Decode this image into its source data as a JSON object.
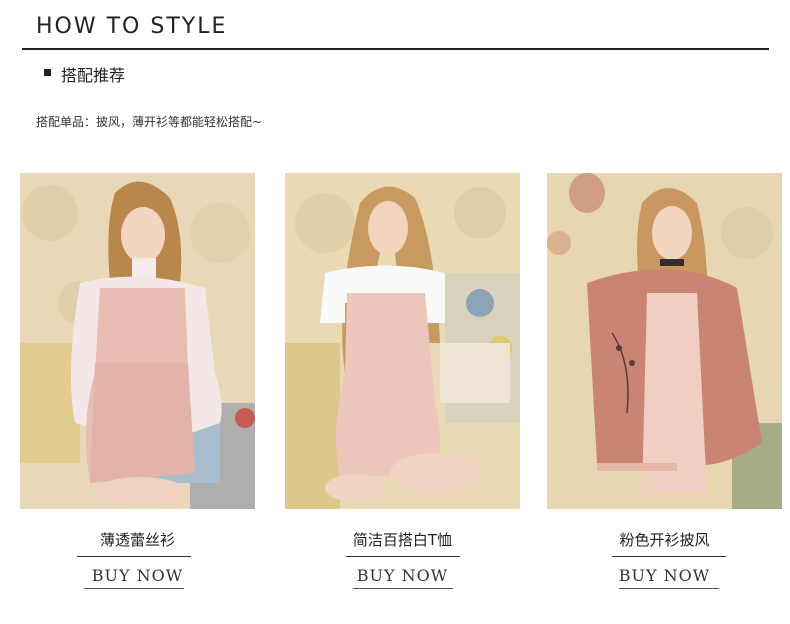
{
  "header": {
    "title": "HOW TO STYLE"
  },
  "section": {
    "title": "搭配推荐"
  },
  "description": "搭配单品：披风，薄开衫等都能轻松搭配~",
  "products": [
    {
      "caption": "薄透蕾丝衫",
      "cta": "BUY NOW"
    },
    {
      "caption": "简洁百搭白T恤",
      "cta": "BUY NOW"
    },
    {
      "caption": "粉色开衫披风",
      "cta": "BUY NOW"
    }
  ],
  "colors": {
    "text": "#222222",
    "wall": "#e6d4b3",
    "dress_pink": "#e9bfb4",
    "cape_pink": "#c98474",
    "hair": "#c69358"
  },
  "icons": [
    "square-bullet-icon"
  ]
}
